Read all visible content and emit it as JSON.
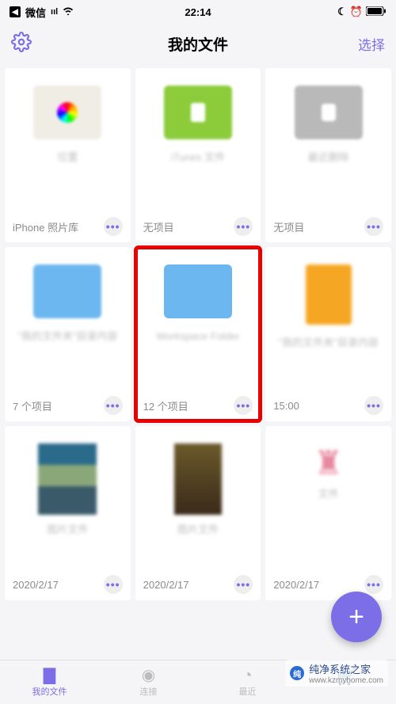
{
  "status": {
    "app": "微信",
    "time": "22:14"
  },
  "nav": {
    "title": "我的文件",
    "select": "选择"
  },
  "cards": [
    {
      "label_blur": "位置",
      "footer": "iPhone 照片库"
    },
    {
      "label_blur": "iTunes 文件",
      "footer": "无项目"
    },
    {
      "label_blur": "最近删除",
      "footer": "无项目"
    },
    {
      "label_blur": "\"我的文件夹\"目录内容",
      "footer": "7 个项目"
    },
    {
      "label_blur": "Workspace Folder",
      "footer": "12 个项目"
    },
    {
      "label_blur": "\"我的文件夹\"目录内容",
      "footer": "15:00"
    },
    {
      "label_blur": "图片文件",
      "footer": "2020/2/17"
    },
    {
      "label_blur": "图片文件",
      "footer": "2020/2/17"
    },
    {
      "label_blur": "文件",
      "footer": "2020/2/17"
    }
  ],
  "tabs": {
    "files": "我的文件",
    "connect": "连接",
    "recent": "最近"
  },
  "watermark": {
    "title": "纯净系统之家",
    "url": "www.kzmyhome.com"
  }
}
